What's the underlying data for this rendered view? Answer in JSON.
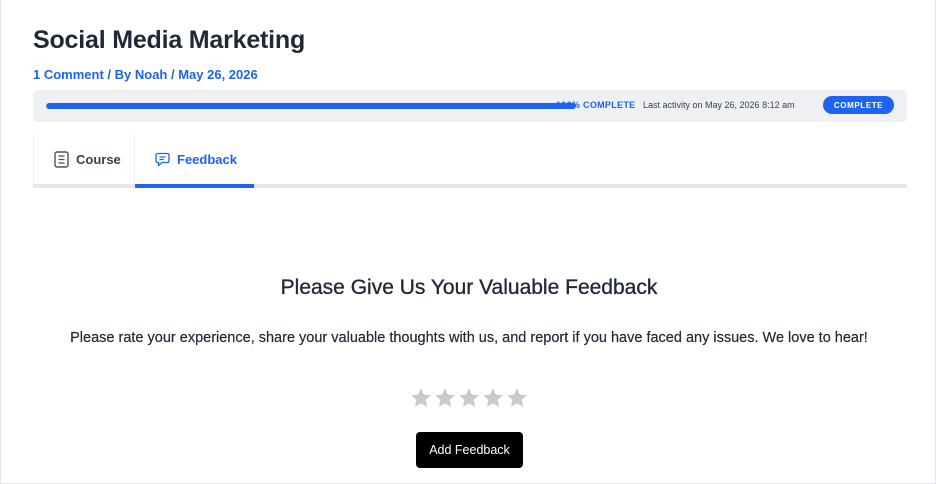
{
  "course": {
    "title": "Social Media Marketing",
    "meta": {
      "comments": "1 Comment",
      "separator": " / ",
      "author": "By Noah",
      "date": "May 26, 2026"
    }
  },
  "progress": {
    "percent": 100,
    "label": "100% COMPLETE",
    "activity": "Last activity on May 26, 2026 8:12 am",
    "status": "COMPLETE",
    "color": "#1d64f2"
  },
  "tabs": [
    {
      "label": "Course",
      "icon": "document-icon",
      "active": false
    },
    {
      "label": "Feedback",
      "icon": "chat-bubble-icon",
      "active": true
    }
  ],
  "feedback": {
    "heading": "Please Give Us Your Valuable Feedback",
    "description": "Please rate your experience, share your valuable thoughts with us, and report if you have faced any issues. We love to hear!",
    "rating": {
      "value": 0,
      "max": 5,
      "star_color": "#c9c9c9"
    },
    "button_label": "Add Feedback"
  }
}
